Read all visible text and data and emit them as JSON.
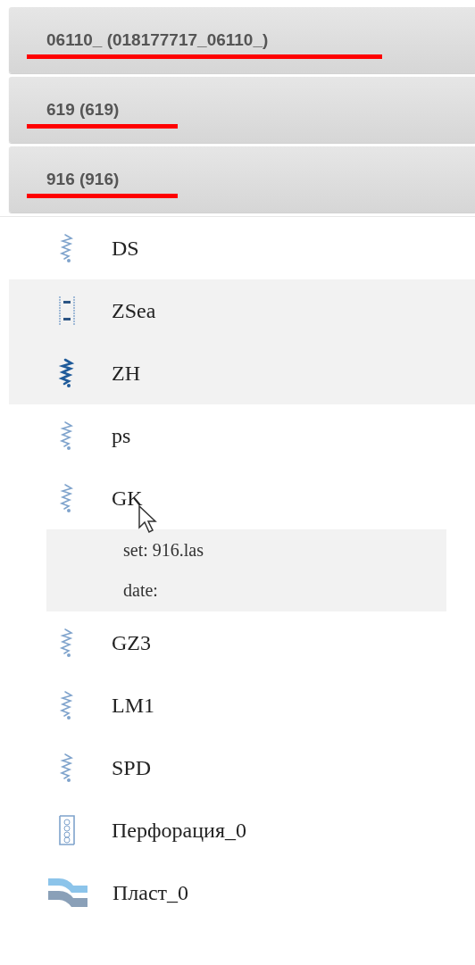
{
  "headers": [
    {
      "label": "06110_ (018177717_06110_)",
      "underlined": true
    },
    {
      "label": "619 (619)",
      "underlined": true
    },
    {
      "label": "916 (916)",
      "underlined": true
    }
  ],
  "items": [
    {
      "kind": "curve",
      "label": "DS",
      "highlighted": false
    },
    {
      "kind": "interval",
      "label": "ZSea",
      "highlighted": true
    },
    {
      "kind": "curve-dark",
      "label": "ZH",
      "highlighted": true
    },
    {
      "kind": "curve",
      "label": "ps",
      "highlighted": false
    },
    {
      "kind": "curve",
      "label": "GK",
      "highlighted": false,
      "hovered": true,
      "details": [
        "set: 916.las",
        "date:"
      ]
    },
    {
      "kind": "curve",
      "label": "GZ3",
      "highlighted": false
    },
    {
      "kind": "curve",
      "label": "LM1",
      "highlighted": false
    },
    {
      "kind": "curve",
      "label": "SPD",
      "highlighted": false
    },
    {
      "kind": "perforation",
      "label": "Перфорация_0",
      "highlighted": false
    },
    {
      "kind": "layer",
      "label": "Пласт_0",
      "highlighted": false
    }
  ]
}
